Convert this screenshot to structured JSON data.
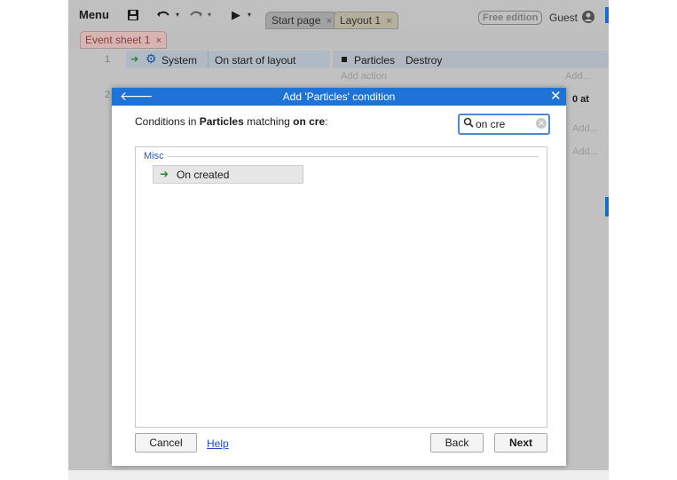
{
  "toolbar": {
    "menu_label": "Menu",
    "save_icon": "floppy-disk-icon",
    "undo_icon": "undo-icon",
    "redo_icon": "redo-icon",
    "run_icon": "play-icon",
    "tabs": [
      "Start page",
      "Layout 1"
    ],
    "free_edition": "Free edition",
    "guest": "Guest"
  },
  "sheet_tab": {
    "label": "Event sheet 1"
  },
  "event_sheet": {
    "row1": {
      "num": "1",
      "object": "System",
      "condition": "On start of layout",
      "action_object": "Particles",
      "action": "Destroy",
      "add_action": "Add action",
      "add": "Add..."
    },
    "row2": {
      "num": "2",
      "partial_text": "0 at"
    },
    "add_links": [
      "Add...",
      "Add..."
    ]
  },
  "dialog": {
    "title": "Add 'Particles' condition",
    "prompt_prefix": "Conditions in ",
    "prompt_object": "Particles",
    "prompt_middle": " matching ",
    "prompt_term": "on cre",
    "prompt_suffix": ":",
    "search_value": "on cre",
    "category": "Misc",
    "items": [
      {
        "label": "On created",
        "icon": "green-arrow-icon"
      }
    ],
    "cancel_label": "Cancel",
    "help_label": "Help",
    "back_label": "Back",
    "next_label": "Next"
  },
  "colors": {
    "title_bar": "#1f73d6",
    "accent_blue": "#1d6ac4",
    "link": "#1f4fd8",
    "condition_arrow": "#2a8a2a"
  }
}
